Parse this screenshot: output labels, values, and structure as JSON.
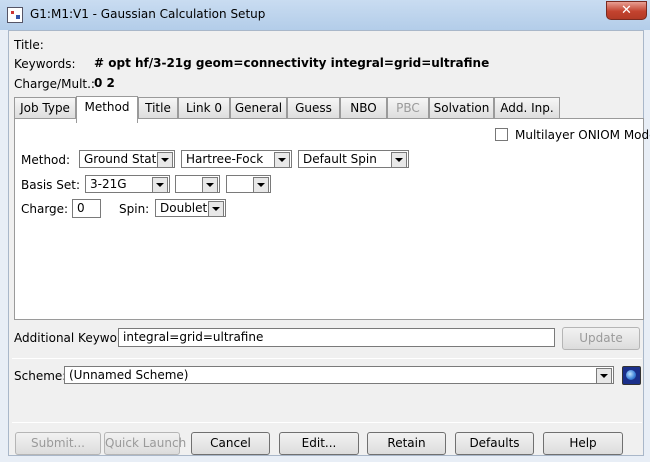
{
  "window": {
    "title": "G1:M1:V1 - Gaussian Calculation Setup",
    "close_symbol": "✕"
  },
  "header": {
    "title_label": "Title:",
    "title_value": "",
    "keywords_label": "Keywords:",
    "keywords_value": "# opt hf/3-21g geom=connectivity integral=grid=ultrafine",
    "charge_label": "Charge/Mult.:",
    "charge_value": "0 2"
  },
  "tabs": [
    {
      "label": "Job Type"
    },
    {
      "label": "Method"
    },
    {
      "label": "Title"
    },
    {
      "label": "Link 0"
    },
    {
      "label": "General"
    },
    {
      "label": "Guess"
    },
    {
      "label": "NBO"
    },
    {
      "label": "PBC"
    },
    {
      "label": "Solvation"
    },
    {
      "label": "Add. Inp."
    }
  ],
  "active_tab": "Method",
  "method_panel": {
    "oniom_label": "Multilayer ONIOM Model",
    "oniom_checked": false,
    "method_label": "Method:",
    "method_state": "Ground State",
    "method_type": "Hartree-Fock",
    "method_spin": "Default Spin",
    "basis_label": "Basis Set:",
    "basis_value": "3-21G",
    "basis_extra1": "",
    "basis_extra2": "",
    "charge_label": "Charge:",
    "charge_value": "0",
    "spin_label": "Spin:",
    "spin_value": "Doublet"
  },
  "additional": {
    "label": "Additional Keywords:",
    "value": "integral=grid=ultrafine",
    "update_label": "Update"
  },
  "scheme": {
    "label": "Scheme:",
    "value": "(Unnamed Scheme)"
  },
  "buttons": {
    "submit": "Submit...",
    "quick_launch": "Quick Launch",
    "cancel": "Cancel",
    "edit": "Edit...",
    "retain": "Retain",
    "defaults": "Defaults",
    "help": "Help"
  }
}
